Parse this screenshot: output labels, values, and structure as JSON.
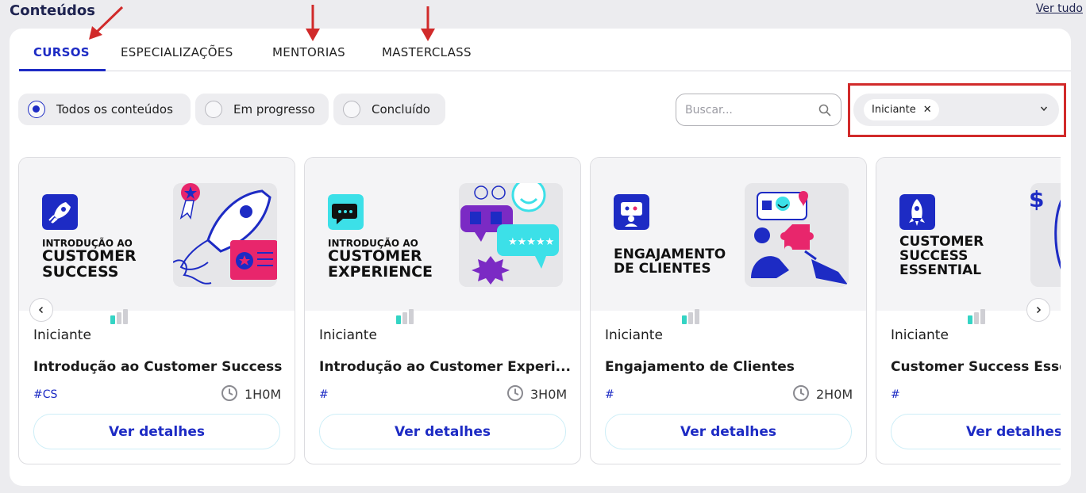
{
  "header": {
    "title": "Conteúdos",
    "see_all": "Ver tudo"
  },
  "tabs": [
    {
      "label": "CURSOS",
      "active": true
    },
    {
      "label": "ESPECIALIZAÇÕES",
      "active": false
    },
    {
      "label": "MENTORIAS",
      "active": false
    },
    {
      "label": "MASTERCLASS",
      "active": false
    }
  ],
  "filters": {
    "status": [
      {
        "label": "Todos os conteúdos",
        "selected": true
      },
      {
        "label": "Em progresso",
        "selected": false
      },
      {
        "label": "Concluído",
        "selected": false
      }
    ],
    "search_placeholder": "Buscar...",
    "level_selected": "Iniciante"
  },
  "courses": [
    {
      "hero_title": "INTRODUÇÃO AO CUSTOMER SUCCESS",
      "hero_line1": "INTRODUÇÃO AO",
      "hero_line2": "CUSTOMER",
      "hero_line3": "SUCCESS",
      "level": "Iniciante",
      "title": "Introdução ao Customer Success",
      "tag": "#CS",
      "duration": "1H0M",
      "button": "Ver detalhes",
      "badge_icon": "rocket-icon"
    },
    {
      "hero_line1": "INTRODUÇÃO AO",
      "hero_line2": "CUSTOMER",
      "hero_line3": "EXPERIENCE",
      "level": "Iniciante",
      "title": "Introdução ao Customer Experi...",
      "tag": "#",
      "duration": "3H0M",
      "button": "Ver detalhes",
      "badge_icon": "chat-icon"
    },
    {
      "hero_line1": "ENGAJAMENTO",
      "hero_line2": "DE CLIENTES",
      "level": "Iniciante",
      "title": "Engajamento de Clientes",
      "tag": "#",
      "duration": "2H0M",
      "button": "Ver detalhes",
      "badge_icon": "engagement-icon"
    },
    {
      "hero_line1": "CUSTOMER",
      "hero_line2": "SUCCESS",
      "hero_line3": "ESSENTIAL",
      "level": "Iniciante",
      "title": "Customer Success Essential",
      "tag": "#",
      "duration": "",
      "button": "Ver detalhes",
      "badge_icon": "rocket-icon"
    }
  ],
  "colors": {
    "accent": "#1d2bc4",
    "highlight": "#d12a2a",
    "level_bar_active": "#34d4c4",
    "level_bar_inactive": "#cfcfd4"
  }
}
